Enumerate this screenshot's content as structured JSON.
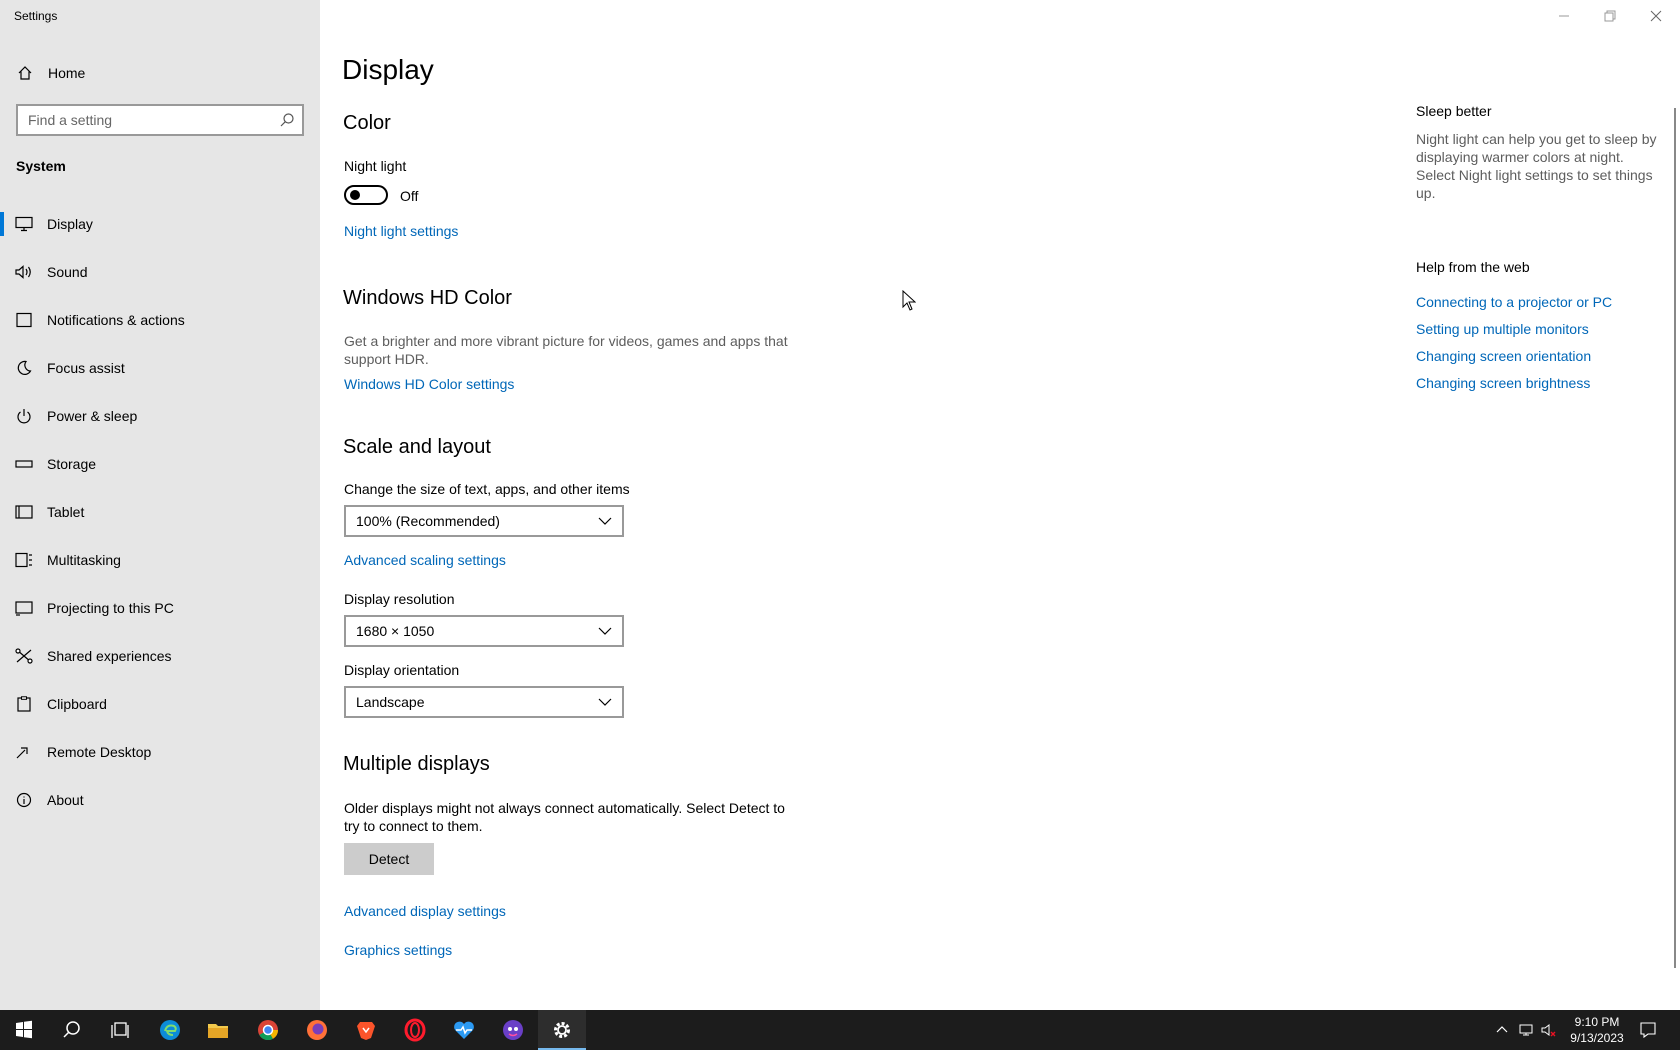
{
  "window": {
    "title": "Settings"
  },
  "sidebar": {
    "home_label": "Home",
    "search_placeholder": "Find a setting",
    "section_label": "System",
    "items": [
      {
        "label": "Display",
        "icon": "monitor-icon",
        "active": true
      },
      {
        "label": "Sound",
        "icon": "speaker-icon"
      },
      {
        "label": "Notifications & actions",
        "icon": "notification-icon"
      },
      {
        "label": "Focus assist",
        "icon": "moon-icon"
      },
      {
        "label": "Power & sleep",
        "icon": "power-icon"
      },
      {
        "label": "Storage",
        "icon": "storage-icon"
      },
      {
        "label": "Tablet",
        "icon": "tablet-icon"
      },
      {
        "label": "Multitasking",
        "icon": "multitasking-icon"
      },
      {
        "label": "Projecting to this PC",
        "icon": "projecting-icon"
      },
      {
        "label": "Shared experiences",
        "icon": "shared-experiences-icon"
      },
      {
        "label": "Clipboard",
        "icon": "clipboard-icon"
      },
      {
        "label": "Remote Desktop",
        "icon": "remote-desktop-icon"
      },
      {
        "label": "About",
        "icon": "info-icon"
      }
    ]
  },
  "main": {
    "title": "Display",
    "color": {
      "heading": "Color",
      "night_light_label": "Night light",
      "night_light_state": "Off",
      "night_light_settings_link": "Night light settings"
    },
    "hd_color": {
      "heading": "Windows HD Color",
      "description": "Get a brighter and more vibrant picture for videos, games and apps that support HDR.",
      "settings_link": "Windows HD Color settings"
    },
    "scale": {
      "heading": "Scale and layout",
      "size_label": "Change the size of text, apps, and other items",
      "size_value": "100% (Recommended)",
      "advanced_scaling_link": "Advanced scaling settings",
      "resolution_label": "Display resolution",
      "resolution_value": "1680 × 1050",
      "orientation_label": "Display orientation",
      "orientation_value": "Landscape"
    },
    "multiple": {
      "heading": "Multiple displays",
      "description": "Older displays might not always connect automatically. Select Detect to try to connect to them.",
      "detect_label": "Detect",
      "advanced_display_link": "Advanced display settings",
      "graphics_link": "Graphics settings"
    }
  },
  "right": {
    "sleep_heading": "Sleep better",
    "sleep_text": "Night light can help you get to sleep by displaying warmer colors at night. Select Night light settings to set things up.",
    "help_heading": "Help from the web",
    "links": [
      "Connecting to a projector or PC",
      "Setting up multiple monitors",
      "Changing screen orientation",
      "Changing screen brightness"
    ]
  },
  "taskbar": {
    "apps": [
      "start-icon",
      "search-icon",
      "task-view-icon",
      "edge-icon",
      "file-explorer-icon",
      "chrome-icon",
      "firefox-icon",
      "brave-icon",
      "opera-icon",
      "health-app-icon",
      "game-app-icon",
      "settings-gear-icon"
    ],
    "time": "9:10 PM",
    "date": "9/13/2023"
  },
  "colors": {
    "accent": "#0078d7",
    "link": "#0067b8",
    "sidebar_bg": "#e6e6e6",
    "taskbar_bg": "#1c1c1c"
  }
}
